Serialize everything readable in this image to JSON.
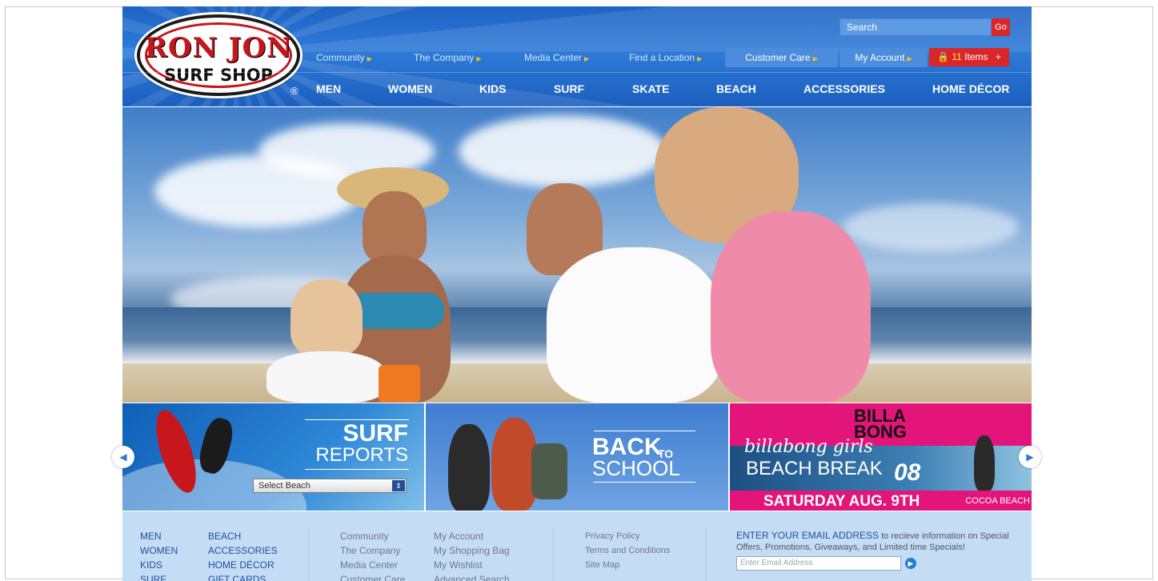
{
  "header": {
    "logo_line1": "RON JON",
    "logo_line2": "SURF SHOP",
    "registered": "®",
    "search_placeholder": "Search",
    "search_go": "Go",
    "top_nav": [
      {
        "label": "Community"
      },
      {
        "label": "The Company"
      },
      {
        "label": "Media Center"
      },
      {
        "label": "Find a Location"
      },
      {
        "label": "Customer Care"
      },
      {
        "label": "My Account"
      }
    ],
    "cart": {
      "count": "11",
      "label": "Items",
      "plus": "+"
    },
    "main_nav": [
      "MEN",
      "WOMEN",
      "KIDS",
      "SURF",
      "SKATE",
      "BEACH",
      "ACCESSORIES",
      "HOME DÉCOR"
    ]
  },
  "promos": {
    "surf": {
      "title1": "SURF",
      "title2": "REPORTS",
      "select_value": "Select Beach"
    },
    "school": {
      "title1": "BACK",
      "title_small": "TO",
      "title2": "SCHOOL"
    },
    "billabong": {
      "brand": "BILLA BONG",
      "script": "billabong girls",
      "event": "BEACH BREAK",
      "year": "08",
      "date": "SATURDAY AUG. 9TH",
      "location": "COCOA BEACH"
    }
  },
  "footer": {
    "col1": [
      "MEN",
      "WOMEN",
      "KIDS",
      "SURF"
    ],
    "col2": [
      "BEACH",
      "ACCESSORIES",
      "HOME DÉCOR",
      "GIFT CARDS"
    ],
    "col3": [
      "Community",
      "The Company",
      "Media Center",
      "Customer Care"
    ],
    "col4": [
      "My Account",
      "My Shopping Bag",
      "My Wishlist",
      "Advanced Search"
    ],
    "col5": [
      "Privacy Policy",
      "Terms and Conditions",
      "Site Map"
    ],
    "email_heading": "ENTER YOUR EMAIL ADDRESS",
    "email_text": " to recieve information on Special Offers, Promotions, Giveaways, and Limited time Specials!",
    "email_placeholder": "Enter Email Address"
  },
  "colors": {
    "brand_blue": "#1d63c4",
    "cart_red": "#d9262b",
    "footer_bg": "#c5dcf5",
    "billabong_pink": "#e3147a"
  }
}
